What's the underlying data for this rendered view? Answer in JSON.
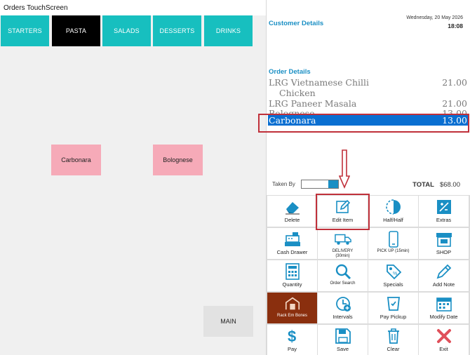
{
  "window": {
    "title": "Orders TouchScreen"
  },
  "categories": [
    {
      "label": "STARTERS",
      "active": false
    },
    {
      "label": "PASTA",
      "active": true
    },
    {
      "label": "SALADS",
      "active": false
    },
    {
      "label": "DESSERTS",
      "active": false
    },
    {
      "label": "DRINKS",
      "active": false
    }
  ],
  "menu_items": [
    {
      "label": "Carbonara"
    },
    {
      "label": "Bolognese"
    }
  ],
  "main_button": {
    "label": "MAIN"
  },
  "customer": {
    "title": "Customer Details",
    "date": "Wednesday, 20 May 2026",
    "time": "18:08"
  },
  "order": {
    "title": "Order Details",
    "lines": [
      {
        "name": "LRG Vietnamese Chilli",
        "price": "21.00"
      },
      {
        "name": "Chicken",
        "price": ""
      },
      {
        "name": "LRG Paneer Masala",
        "price": "21.00"
      },
      {
        "name": "Bolognese",
        "price": "13.00"
      },
      {
        "name": "Carbonara",
        "price": "13.00"
      }
    ]
  },
  "taken_by": {
    "label": "Taken By",
    "value": ""
  },
  "total": {
    "label": "TOTAL",
    "value": "$68.00"
  },
  "actions": [
    {
      "label": "Delete",
      "icon": "eraser-icon"
    },
    {
      "label": "Edit Item",
      "icon": "edit-icon"
    },
    {
      "label": "Half/Half",
      "icon": "half-circle-icon"
    },
    {
      "label": "Extras",
      "icon": "extras-icon"
    },
    {
      "label": "Cash Drawer",
      "icon": "cash-register-icon"
    },
    {
      "label": "DELIVERY\n(30min)",
      "icon": "delivery-truck-icon"
    },
    {
      "label": "PICK UP (15min)",
      "icon": "mobile-phone-icon"
    },
    {
      "label": "SHOP",
      "icon": "shop-icon"
    },
    {
      "label": "Quantity",
      "icon": "calculator-icon"
    },
    {
      "label": "Order Search",
      "icon": "search-icon"
    },
    {
      "label": "Specials",
      "icon": "specials-tag-icon"
    },
    {
      "label": "Add Note",
      "icon": "pencil-icon"
    },
    {
      "label": "Rack Em Bones",
      "icon": "rack-em-bones-logo"
    },
    {
      "label": "Intervals",
      "icon": "clock-plus-icon"
    },
    {
      "label": "Pay Pickup",
      "icon": "pay-pickup-icon"
    },
    {
      "label": "Modify Date",
      "icon": "calendar-icon"
    },
    {
      "label": "Pay",
      "icon": "dollar-icon"
    },
    {
      "label": "Save",
      "icon": "save-icon"
    },
    {
      "label": "Clear",
      "icon": "trash-icon"
    },
    {
      "label": "Exit",
      "icon": "close-icon"
    }
  ],
  "colors": {
    "accent": "#17bfbf",
    "brand_blue": "#1a8fc4",
    "selected": "#0a6fd1",
    "item_pink": "#f6aab8",
    "highlight_red": "#c0303a",
    "exit_red": "#e0505a"
  }
}
